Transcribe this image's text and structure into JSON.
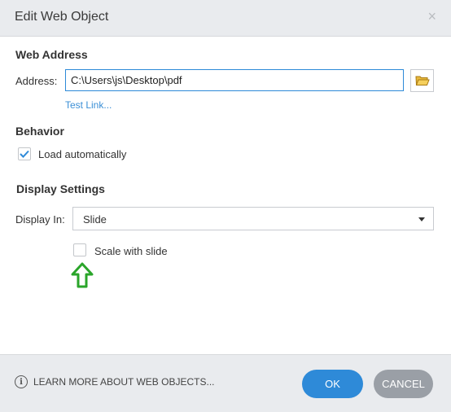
{
  "dialog": {
    "title": "Edit Web Object",
    "close_glyph": "×"
  },
  "web_address": {
    "heading": "Web Address",
    "address_label": "Address:",
    "address_value": "C:\\Users\\js\\Desktop\\pdf",
    "browse_icon": "folder-open-icon",
    "test_link": "Test Link..."
  },
  "behavior": {
    "heading": "Behavior",
    "load_automatically_label": "Load automatically",
    "load_automatically_checked": true
  },
  "display_settings": {
    "heading": "Display Settings",
    "display_in_label": "Display In:",
    "display_in_value": "Slide",
    "scale_with_slide_label": "Scale with slide",
    "scale_with_slide_checked": false
  },
  "annotation": {
    "icon": "up-arrow-icon",
    "color": "#2aa52a"
  },
  "footer": {
    "learn_more": "LEARN MORE ABOUT WEB OBJECTS...",
    "ok_label": "OK",
    "cancel_label": "CANCEL"
  },
  "colors": {
    "accent": "#2e8ad8",
    "link": "#3b8fd6",
    "cancel_button": "#9a9fa6",
    "chrome": "#e9ebee"
  }
}
